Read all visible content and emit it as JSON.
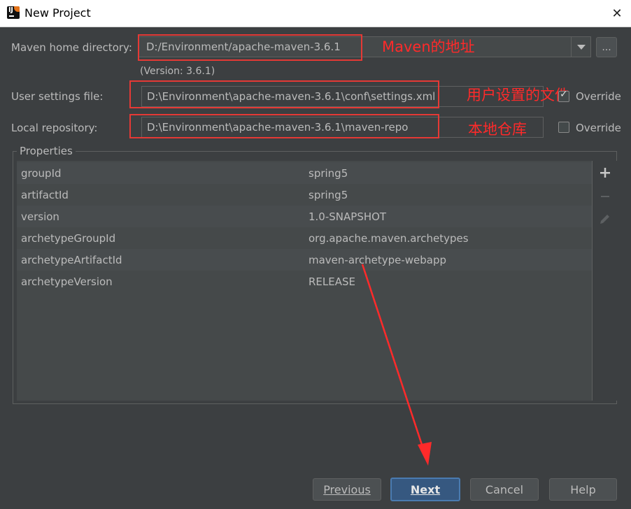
{
  "window": {
    "title": "New Project"
  },
  "maven_home": {
    "label": "Maven home directory:",
    "value": "D:/Environment/apache-maven-3.6.1",
    "version": "(Version: 3.6.1)",
    "browse_label": "...",
    "annotation": "Maven的地址"
  },
  "user_settings": {
    "label": "User settings file:",
    "value": "D:\\Environment\\apache-maven-3.6.1\\conf\\settings.xml",
    "override_label": "Override",
    "override_checked": true,
    "annotation": "用户设置的文件"
  },
  "local_repo": {
    "label": "Local repository:",
    "value": "D:\\Environment\\apache-maven-3.6.1\\maven-repo",
    "override_label": "Override",
    "override_checked": false,
    "annotation": "本地仓库"
  },
  "properties": {
    "title": "Properties",
    "rows": [
      {
        "key": "groupId",
        "value": "spring5"
      },
      {
        "key": "artifactId",
        "value": "spring5"
      },
      {
        "key": "version",
        "value": "1.0-SNAPSHOT"
      },
      {
        "key": "archetypeGroupId",
        "value": "org.apache.maven.archetypes"
      },
      {
        "key": "archetypeArtifactId",
        "value": "maven-archetype-webapp"
      },
      {
        "key": "archetypeVersion",
        "value": "RELEASE"
      }
    ],
    "toolbar": {
      "add_icon": "plus-icon",
      "remove_icon": "minus-icon",
      "edit_icon": "pencil-icon"
    }
  },
  "buttons": {
    "previous": "Previous",
    "next": "Next",
    "cancel": "Cancel",
    "help": "Help"
  },
  "colors": {
    "annotation": "#ff2a2a",
    "accent": "#365880"
  }
}
